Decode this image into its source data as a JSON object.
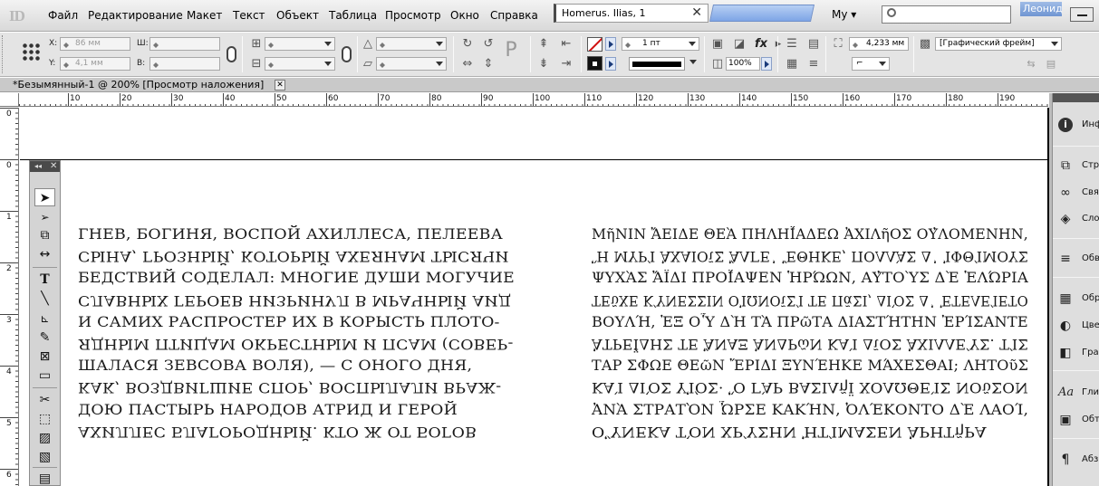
{
  "app": {
    "logo": "ID",
    "menu": [
      "Файл",
      "Редактирование",
      "Макет",
      "Текст",
      "Объект",
      "Таблица",
      "Просмотр",
      "Окно",
      "Справка"
    ],
    "document_tab": "Homerus. Ilias, 1",
    "document_tab_close": "✕",
    "workspace": "My ▾",
    "search_placeholder": "",
    "user": "Леонид"
  },
  "control_panel": {
    "x_label": "X:",
    "x_value": "86 мм",
    "y_label": "Y:",
    "y_value": "4,1 мм",
    "w_label": "Ш:",
    "w_value": "",
    "h_label": "В:",
    "h_value": "",
    "stroke_weight": "1 пт",
    "opacity": "100%",
    "offset": "4,233 мм",
    "object_style": "[Графический фрейм]"
  },
  "document": {
    "title": "*Безымянный-1 @ 200% [Просмотр наложения]",
    "close": "✕"
  },
  "ruler": {
    "h_labels": [
      "10",
      "20",
      "30",
      "40",
      "50",
      "60",
      "70",
      "80",
      "90",
      "100",
      "110",
      "120",
      "130",
      "140",
      "150",
      "160",
      "170",
      "180",
      "190",
      "20"
    ],
    "v_labels": [
      "0",
      "0",
      "1",
      "2",
      "3",
      "4",
      "5",
      "6"
    ]
  },
  "text_left": [
    "ГНЕВ, БОГИНЯ, ВОСПОЙ АХИЛЛЕСА, ПЕЛЕЕВА",
    "СЫНА, ГРОЗНЫЙ, КОТОРЫЙ АХЕЯНАМ ТЫСЯЧИ",
    "БЕДСТВИЙ СОДЕЛАЛ: МНОГИЕ ДУШИ МОГУЧИЕ",
    "СЛАВНЫХ ГЕРОЕВ НИЗРИНУЛ В МРАЧНЫЙ АИД",
    "И САМИХ РАСПРОСТЕР ИХ В КОРЫСТЬ ПЛОТО-",
    "ЯДНЫМ ПТИЦАМ ОКРЕСТНЫМ И ПСАМ (СОВЕР-",
    "ШАЛАСЯ ЗЕВСОВА ВОЛЯ), — С ОНОГО ДНЯ,",
    "КАК, ВОЗДВИГШИЕ СПОР, ВОСПЫЛАЛИ ВРАЖ-",
    "ДОЮ ПАСТЫРЬ НАРОДОВ АТРИД И ГЕРОЙ",
    "АХИЛЛЕС БЛАГОРОДНЫЙ. КТО Ж ОТ БОГОВ"
  ],
  "text_right": [
    "ΜῆΝΙΝ ἌΕΙΔΕ ΘΕᾺ ΠΗΛΗΪ́ΑΔΕΩ ἈΧΙΛῆΟΣ ΟΥ̓ΛΟΜΕΝΗΝ,",
    "Ἣ ΜΥΡΊ ἈΧΑΙΟῖΣ ἌΛΓΕ᾽ ἜΘΗΚΕ, ΠΟΛΛᾺΣ Δ᾽ ἸΦΘΊΜΟΥΣ",
    "ΨΥΧᾺΣ ἌΪΔΙ ΠΡΟΪ́ΑΨΕΝ ἩΡΏΩΝ, ΑΥ̓ΤΟῪΣ ΔῈ ἙΛΏΡΙΑ",
    "ΤΕῦΧΕ ΚΎΝΕΣΣΙΝ ΟἸΩΝΟῖΣΊ ΤΕ ΠᾶΣΙ, ΔΙῸΣ Δ᾽ ἘΤΕΛΕΊΕΤΟ",
    "ΒΟΥΛΉ, ἘΞ ΟὟ ΔῊ ΤᾺ ΠΡῶΤΑ ΔΙΑΣΤΉΤΗΝ ἘΡΊΣΑΝΤΕ",
    "ἈΤΡΕΪ́ΔΗΣ ΤΕ ἌΝΑΞ ἈΝΔΡῶΝ ΚΑῚ ΔῖΟΣ ἈΧΙΛΛΕΎΣ. ΤΊΣ",
    "ΤΑΡ ΣΦΩΕ ΘΕῶΝ ἜΡΙΔΙ ΞΥΝΈΗΚΕ ΜΆΧΕΣΘΑΙ; ΛΗΤΟῦΣ",
    "ΚΑῚ ΔΙῸΣ ΥἹΌΣ· Ὃ ΓᾺΡ ΒΑΣΙΛῆΪ ΧΟΛΩΘΕῚΣ ΝΟῦΣΟΝ",
    "ἈΝᾺ ΣΤΡΑΤῸΝ ὮΡΣΕ ΚΑΚΉΝ, ὈΛΈΚΟΝΤΟ ΔῈ ΛΑΟΊ,",
    "ΟὝΝΕΚΑ ΤῸΝ ΧΡΎΣΗΝ ἨΤΊΜΑΣΕΝ ἈΡΗΤῆΡΑ"
  ],
  "tools": {
    "collapse": "◂◂",
    "close": "✕"
  },
  "dock": {
    "items": [
      "Инф",
      "Стр",
      "Свя",
      "Сло",
      "Обв",
      "Обр",
      "Цве",
      "Гра",
      "Гли",
      "Обт",
      "Абз"
    ]
  },
  "colors": {
    "menubar": "#e5e5e5",
    "panel": "#e4e4e4",
    "accent_blue": "#7ea5e6",
    "text": "#1a1a1a"
  }
}
